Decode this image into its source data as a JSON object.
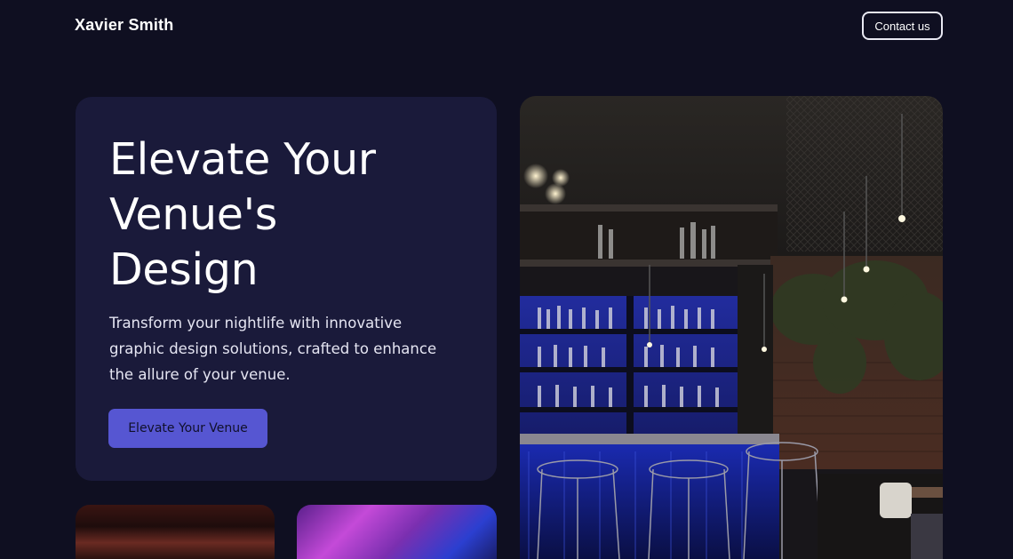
{
  "header": {
    "brand": "Xavier Smith",
    "contact_label": "Contact us"
  },
  "hero": {
    "title_lines": [
      "Elevate Your",
      "Venue's",
      "Design"
    ],
    "subtitle_lines": [
      "Transform your nightlife with innovative",
      "graphic design solutions, crafted to enhance",
      "the allure of your venue."
    ],
    "cta_label": "Elevate Your Venue"
  },
  "colors": {
    "page_bg": "#0f0f21",
    "card_bg": "#1a1a3a",
    "accent": "#5656d2"
  }
}
